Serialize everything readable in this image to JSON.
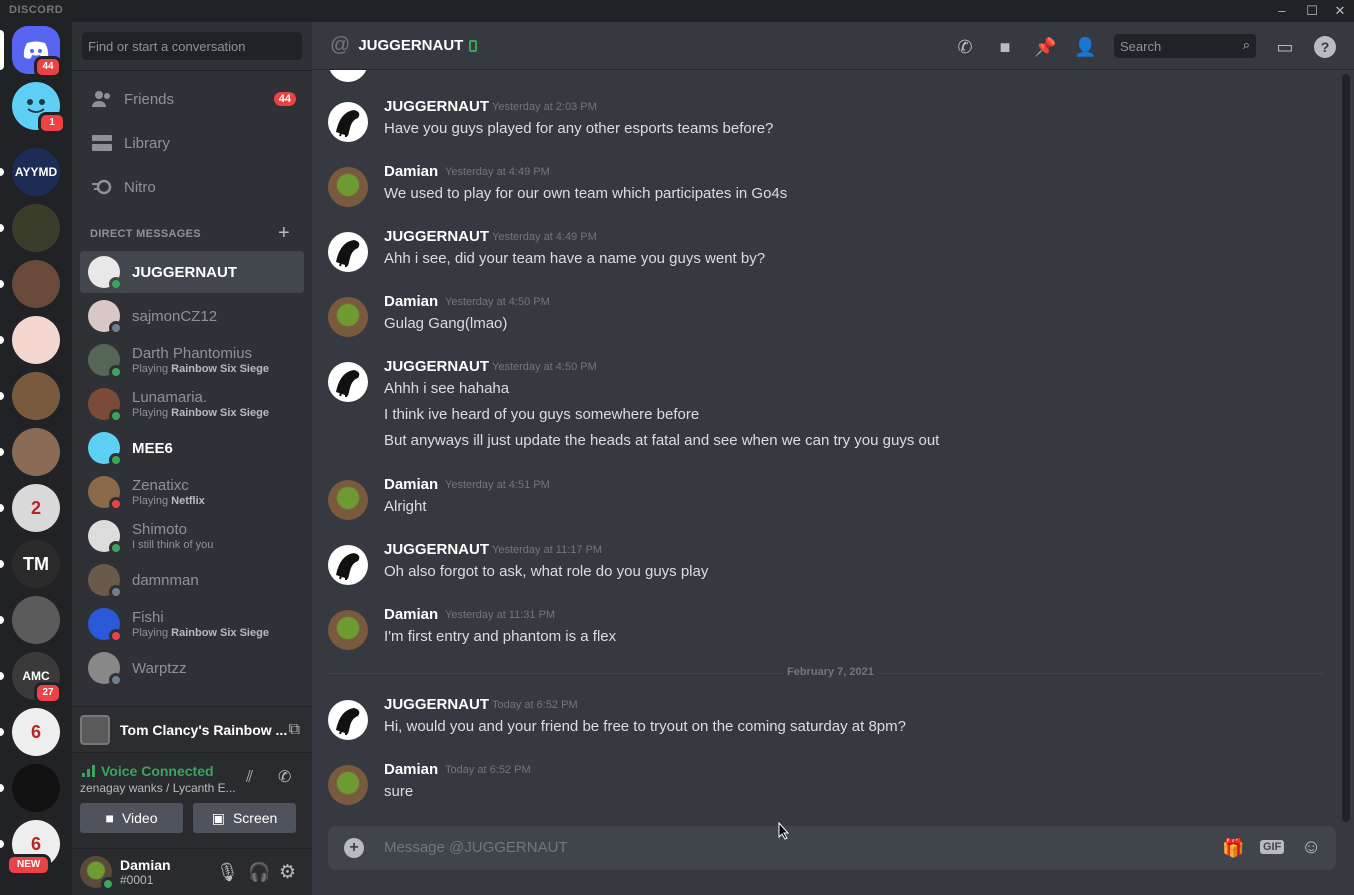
{
  "window": {
    "brand": "DISCORD",
    "minimize": "–",
    "maximize": "☐",
    "close": "✕"
  },
  "servers": [
    {
      "name": "home",
      "badge": "44",
      "color": "#5865f2"
    },
    {
      "name": "MEE6",
      "badge": "1",
      "color": "#5ed0f6"
    },
    {
      "name": "AYYMD",
      "label": "AYYMD",
      "color": "#1c2c55"
    },
    {
      "name": "server-4",
      "color": "#3a3d2a"
    },
    {
      "name": "server-5",
      "color": "#6a4a3a"
    },
    {
      "name": "server-6",
      "color": "#f4d7d0"
    },
    {
      "name": "server-7",
      "color": "#7a5a3e"
    },
    {
      "name": "server-8",
      "color": "#8a6b55"
    },
    {
      "name": "server-9",
      "label": "2",
      "color": "#d9d9d9"
    },
    {
      "name": "TM",
      "label": "TM",
      "color": "#2a2a2a"
    },
    {
      "name": "server-11",
      "color": "#5a5a5a"
    },
    {
      "name": "AMC",
      "label": "AMC",
      "badge": "27",
      "color": "#3a3a3a"
    },
    {
      "name": "R6",
      "label": "6",
      "color": "#eeeeee"
    },
    {
      "name": "server-14",
      "color": "#111111"
    },
    {
      "name": "R6-new",
      "label": "6",
      "badge": "NEW",
      "color": "#eeeeee"
    }
  ],
  "sidebar": {
    "search_placeholder": "Find or start a conversation",
    "nav": [
      {
        "label": "Friends",
        "badge": "44"
      },
      {
        "label": "Library"
      },
      {
        "label": "Nitro"
      }
    ],
    "dm_header": "DIRECT MESSAGES",
    "dm_add": "+",
    "dms": [
      {
        "name": "JUGGERNAUT",
        "status": "#3ba55d",
        "selected": true,
        "avatar": "#e8e8e8"
      },
      {
        "name": "sajmonCZ12",
        "status": "#747f8d",
        "avatar": "#d8c8c8"
      },
      {
        "name": "Darth Phantomius",
        "activity": "Playing ",
        "game": "Rainbow Six Siege",
        "status": "#3ba55d",
        "avatar": "#556655"
      },
      {
        "name": "Lunamaria.",
        "activity": "Playing ",
        "game": "Rainbow Six Siege",
        "status": "#3ba55d",
        "avatar": "#7a4a3a"
      },
      {
        "name": "MEE6",
        "status": "#3ba55d",
        "bold": true,
        "avatar": "#5ed0f6"
      },
      {
        "name": "Zenatixc",
        "activity": "Playing ",
        "game": "Netflix",
        "status": "#ed4245",
        "avatar": "#8a6a4a"
      },
      {
        "name": "Shimoto",
        "activity": "I still think of you",
        "status": "#3ba55d",
        "avatar": "#dddddd"
      },
      {
        "name": "damnman",
        "status": "#747f8d",
        "avatar": "#6a5a4a"
      },
      {
        "name": "Fishi",
        "activity": "Playing ",
        "game": "Rainbow Six Siege",
        "status": "#ed4245",
        "avatar": "#2a5ad8"
      },
      {
        "name": "Warptzz",
        "status": "#747f8d",
        "avatar": "#888888"
      }
    ],
    "activity_game": "Tom Clancy's Rainbow ...",
    "voice": {
      "status": "Voice Connected",
      "channel": "zenagay wanks / Lycanth E...",
      "video_label": "Video",
      "screen_label": "Screen"
    },
    "user": {
      "name": "Damian",
      "tag": "#0001"
    }
  },
  "header": {
    "title": "JUGGERNAUT",
    "search_placeholder": "Search"
  },
  "messages": [
    {
      "author": "JUGGERNAUT",
      "time": "Yesterday at 2:03 PM",
      "lines": [
        "Have you guys played for any other esports teams before?"
      ]
    },
    {
      "author": "Damian",
      "time": "Yesterday at 4:49 PM",
      "lines": [
        "We used to play for our own team which participates in Go4s"
      ]
    },
    {
      "author": "JUGGERNAUT",
      "time": "Yesterday at 4:49 PM",
      "lines": [
        "Ahh i see, did your team have a name you guys went by?"
      ]
    },
    {
      "author": "Damian",
      "time": "Yesterday at 4:50 PM",
      "lines": [
        "Gulag Gang(lmao)"
      ]
    },
    {
      "author": "JUGGERNAUT",
      "time": "Yesterday at 4:50 PM",
      "lines": [
        "Ahhh i see hahaha",
        "I think ive heard of you guys somewhere before",
        "But anyways ill just update the heads at fatal and see when we can try you guys out"
      ]
    },
    {
      "author": "Damian",
      "time": "Yesterday at 4:51 PM",
      "lines": [
        "Alright"
      ]
    },
    {
      "author": "JUGGERNAUT",
      "time": "Yesterday at 11:17 PM",
      "lines": [
        "Oh also forgot to ask, what role do you guys play"
      ]
    },
    {
      "author": "Damian",
      "time": "Yesterday at 11:31 PM",
      "lines": [
        "I'm first entry and phantom is a flex"
      ]
    },
    {
      "author": "JUGGERNAUT",
      "time": "Today at 6:52 PM",
      "lines": [
        "Hi, would you and your friend be free to tryout on the coming saturday at 8pm?"
      ]
    },
    {
      "author": "Damian",
      "time": "Today at 6:52 PM",
      "lines": [
        "sure"
      ]
    }
  ],
  "date_divider": "February 7, 2021",
  "composer": {
    "placeholder": "Message @JUGGERNAUT",
    "gif": "GIF"
  }
}
